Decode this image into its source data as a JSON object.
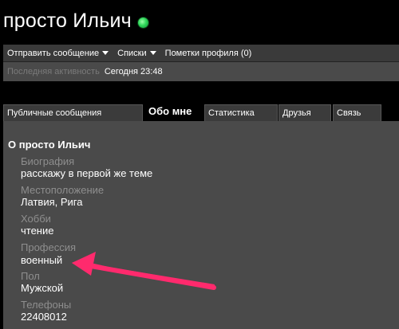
{
  "header": {
    "title": "просто Ильич",
    "online_status_color": "#2ed65a"
  },
  "actions": {
    "send_message": "Отправить сообщение",
    "lists": "Списки",
    "profile_notes": "Пометки профиля (0)"
  },
  "activity": {
    "label": "Последняя активность",
    "value": "Сегодня 23:48"
  },
  "tabs": {
    "public_messages": "Публичные сообщения",
    "about_me": "Обо мне",
    "statistics": "Статистика",
    "friends": "Друзья",
    "contact": "Связь"
  },
  "about": {
    "section_title": "О просто Ильич",
    "fields": [
      {
        "label": "Биография",
        "value": "расскажу в первой же теме"
      },
      {
        "label": "Местоположение",
        "value": "Латвия, Рига"
      },
      {
        "label": "Хобби",
        "value": "чтение"
      },
      {
        "label": "Профессия",
        "value": "военный"
      },
      {
        "label": "Пол",
        "value": "Мужской"
      },
      {
        "label": "Телефоны",
        "value": "22408012"
      }
    ]
  },
  "annotation": {
    "arrow_color": "#ff2a6d"
  }
}
